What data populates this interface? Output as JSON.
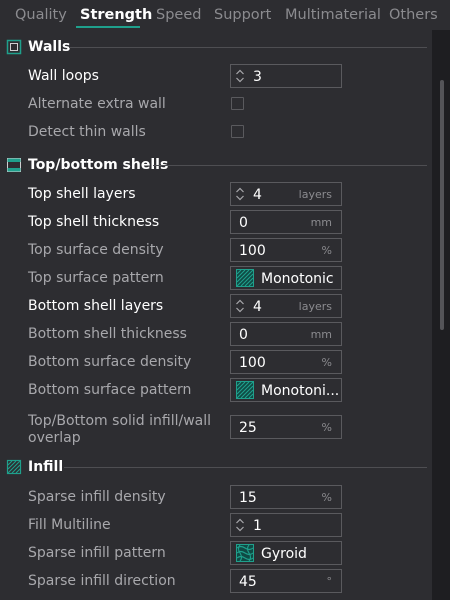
{
  "tabs": [
    {
      "label": "Quality"
    },
    {
      "label": "Strength",
      "active": true
    },
    {
      "label": "Speed"
    },
    {
      "label": "Support"
    },
    {
      "label": "Multimaterial"
    },
    {
      "label": "Others"
    }
  ],
  "accent_color": "#1fa08c",
  "sections": {
    "walls": {
      "title": "Walls",
      "icon": "walls-icon",
      "wall_loops": {
        "label": "Wall loops",
        "value": "3"
      },
      "alternate_extra_wall": {
        "label": "Alternate extra wall",
        "checked": false
      },
      "detect_thin_walls": {
        "label": "Detect thin walls",
        "checked": false
      }
    },
    "shells": {
      "title": "Top/bottom shells",
      "icon": "shells-icon",
      "top_shell_layers": {
        "label": "Top shell layers",
        "value": "4",
        "unit": "layers"
      },
      "top_shell_thickness": {
        "label": "Top shell thickness",
        "value": "0",
        "unit": "mm"
      },
      "top_surface_density": {
        "label": "Top surface density",
        "value": "100",
        "unit": "%"
      },
      "top_surface_pattern": {
        "label": "Top surface pattern",
        "value": "Monotonic"
      },
      "bottom_shell_layers": {
        "label": "Bottom shell layers",
        "value": "4",
        "unit": "layers"
      },
      "bottom_shell_thickness": {
        "label": "Bottom shell thickness",
        "value": "0",
        "unit": "mm"
      },
      "bottom_surface_density": {
        "label": "Bottom surface density",
        "value": "100",
        "unit": "%"
      },
      "bottom_surface_pattern": {
        "label": "Bottom surface pattern",
        "value": "Monotoni..."
      },
      "solid_infill_overlap": {
        "label": "Top/Bottom solid infill/wall overlap",
        "value": "25",
        "unit": "%"
      }
    },
    "infill": {
      "title": "Infill",
      "icon": "infill-icon",
      "sparse_infill_density": {
        "label": "Sparse infill density",
        "value": "15",
        "unit": "%"
      },
      "fill_multiline": {
        "label": "Fill Multiline",
        "value": "1"
      },
      "sparse_infill_pattern": {
        "label": "Sparse infill pattern",
        "value": "Gyroid"
      },
      "sparse_infill_direction": {
        "label": "Sparse infill direction",
        "value": "45",
        "unit": "°"
      }
    }
  }
}
